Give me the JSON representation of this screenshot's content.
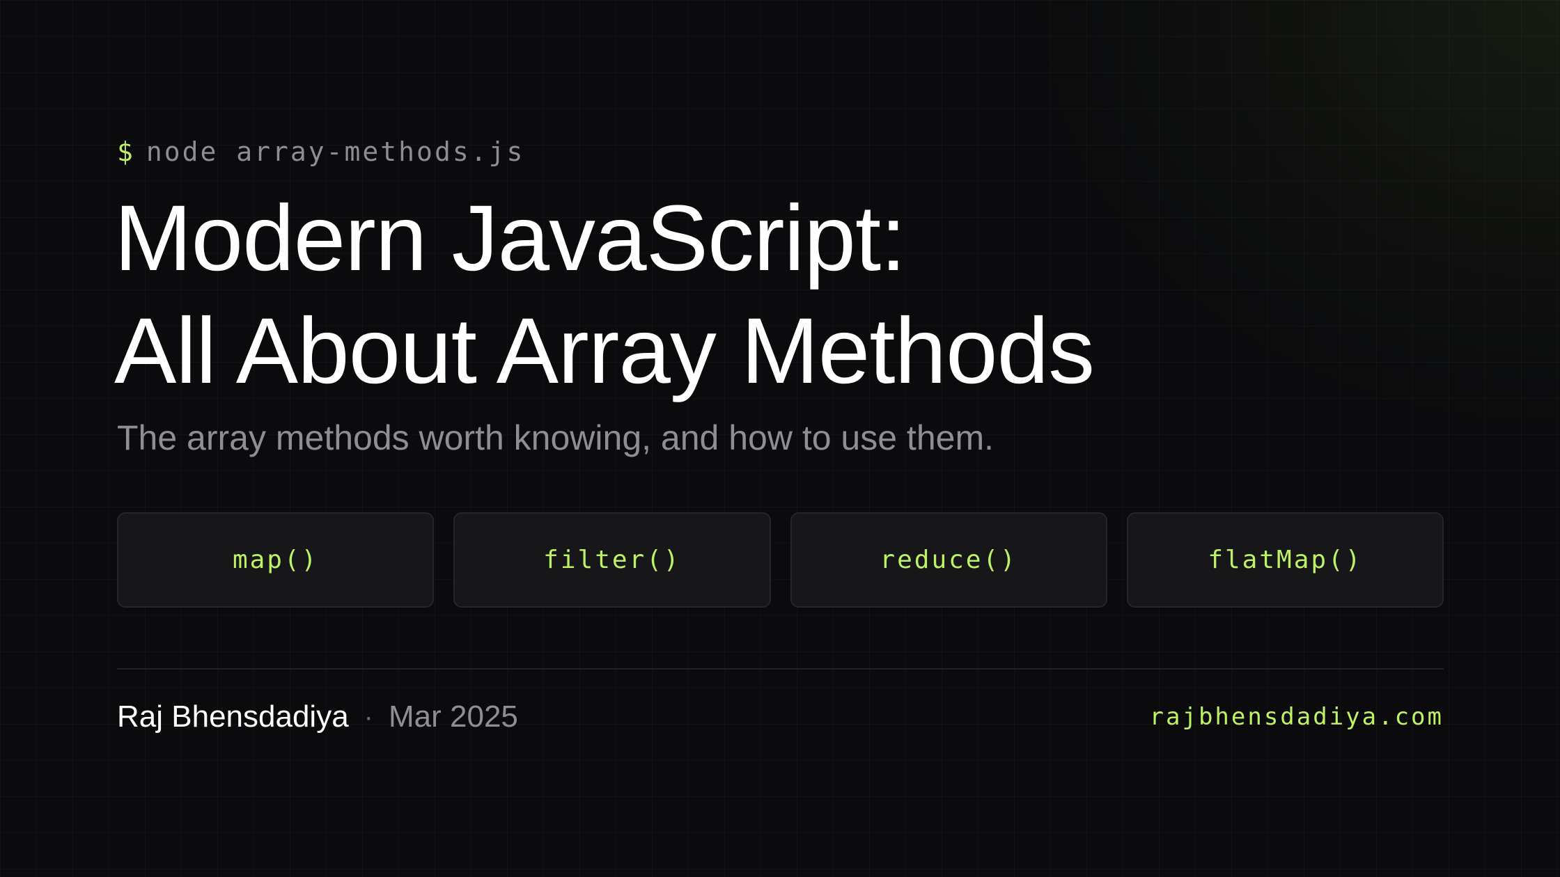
{
  "prompt": {
    "symbol": "$",
    "command": "node array-methods.js"
  },
  "title": {
    "line1": "Modern JavaScript:",
    "line2": "All About Array Methods"
  },
  "subtitle": "The array methods worth knowing, and how to use them.",
  "methods": [
    {
      "label": "map()"
    },
    {
      "label": "filter()"
    },
    {
      "label": "reduce()"
    },
    {
      "label": "flatMap()"
    }
  ],
  "footer": {
    "author": "Raj Bhensdadiya",
    "separator": "·",
    "date": "Mar 2025",
    "website": "rajbhensdadiya.com"
  },
  "colors": {
    "background": "#0b0b0d",
    "accent": "#bef264",
    "text": "#ffffff",
    "muted": "#8e8e94",
    "card": "#17171a"
  }
}
